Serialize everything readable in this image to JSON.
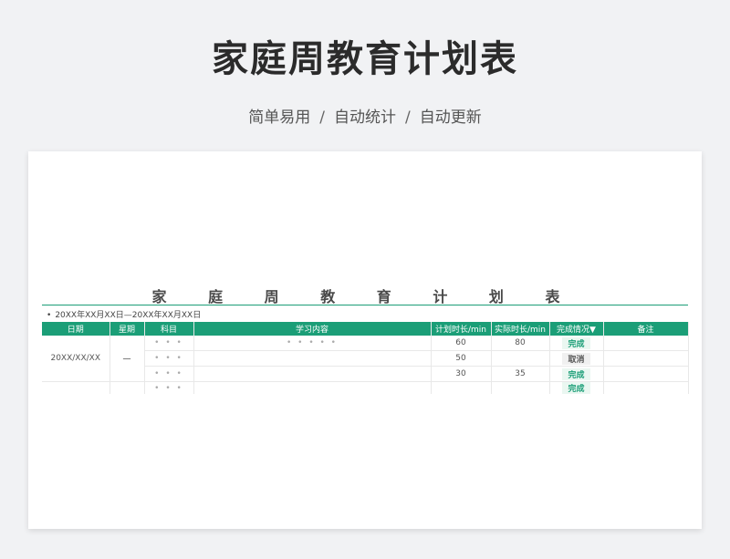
{
  "hero": {
    "title": "家庭周教育计划表",
    "subtitle_parts": [
      "简单易用",
      "自动统计",
      "自动更新"
    ],
    "separator": "/"
  },
  "sheet": {
    "title": "家 庭 周 教 育 计 划 表",
    "date_range": "20XX年XX月XX日—20XX年XX月XX日",
    "accent_color": "#1b9e77",
    "headers": [
      "日期",
      "星期",
      "科目",
      "学习内容",
      "计划时长/min",
      "实际时长/min",
      "完成情况▼",
      "备注"
    ],
    "date": "20XX/XX/XX",
    "weekday": "一",
    "rows": [
      {
        "subject": "• • •",
        "content": "• • • • •",
        "planned": "60",
        "actual": "80",
        "status": "完成",
        "status_type": "done",
        "note": ""
      },
      {
        "subject": "• • •",
        "content": "",
        "planned": "50",
        "actual": "",
        "status": "取消",
        "status_type": "cancel",
        "note": ""
      },
      {
        "subject": "• • •",
        "content": "",
        "planned": "30",
        "actual": "35",
        "status": "完成",
        "status_type": "done",
        "note": ""
      },
      {
        "subject": "• • •",
        "content": "",
        "planned": "",
        "actual": "",
        "status": "完成",
        "status_type": "done",
        "note": ""
      }
    ]
  }
}
